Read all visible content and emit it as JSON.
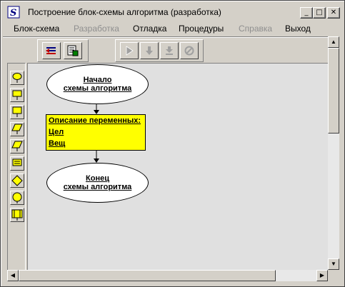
{
  "window": {
    "title": "Построение блок-схемы алгоритма (разработка)",
    "controls": {
      "minimize": "_",
      "maximize": "□",
      "close": "✕"
    }
  },
  "menu": [
    {
      "label": "Блок-схема",
      "enabled": true
    },
    {
      "label": "Разработка",
      "enabled": false
    },
    {
      "label": "Отладка",
      "enabled": true
    },
    {
      "label": "Процедуры",
      "enabled": true
    },
    {
      "label": "Справка",
      "enabled": false
    },
    {
      "label": "Выход",
      "enabled": true
    }
  ],
  "toolbar": {
    "group1": [
      "variables-icon",
      "compile-icon"
    ],
    "group2": [
      "run-icon",
      "step-into-icon",
      "step-over-icon",
      "stop-icon"
    ]
  },
  "palette": [
    "input-block-icon",
    "output-block-icon",
    "assignment-block-icon",
    "io-parallelogram-icon",
    "data-parallelogram-icon",
    "process-block-icon",
    "decision-block-icon",
    "loop-block-icon",
    "subroutine-block-icon"
  ],
  "flowchart": {
    "start": {
      "line1": "Начало",
      "line2": "схемы алгоритма"
    },
    "vars": {
      "title": "Описание переменных:",
      "line1": "Цел",
      "line2": "Вещ"
    },
    "end": {
      "line1": "Конец",
      "line2": "схемы алгоритма"
    }
  },
  "colors": {
    "block_fill": "#ffff00",
    "canvas_bg": "#e0e0e0",
    "oval_fill": "#ffffff"
  }
}
